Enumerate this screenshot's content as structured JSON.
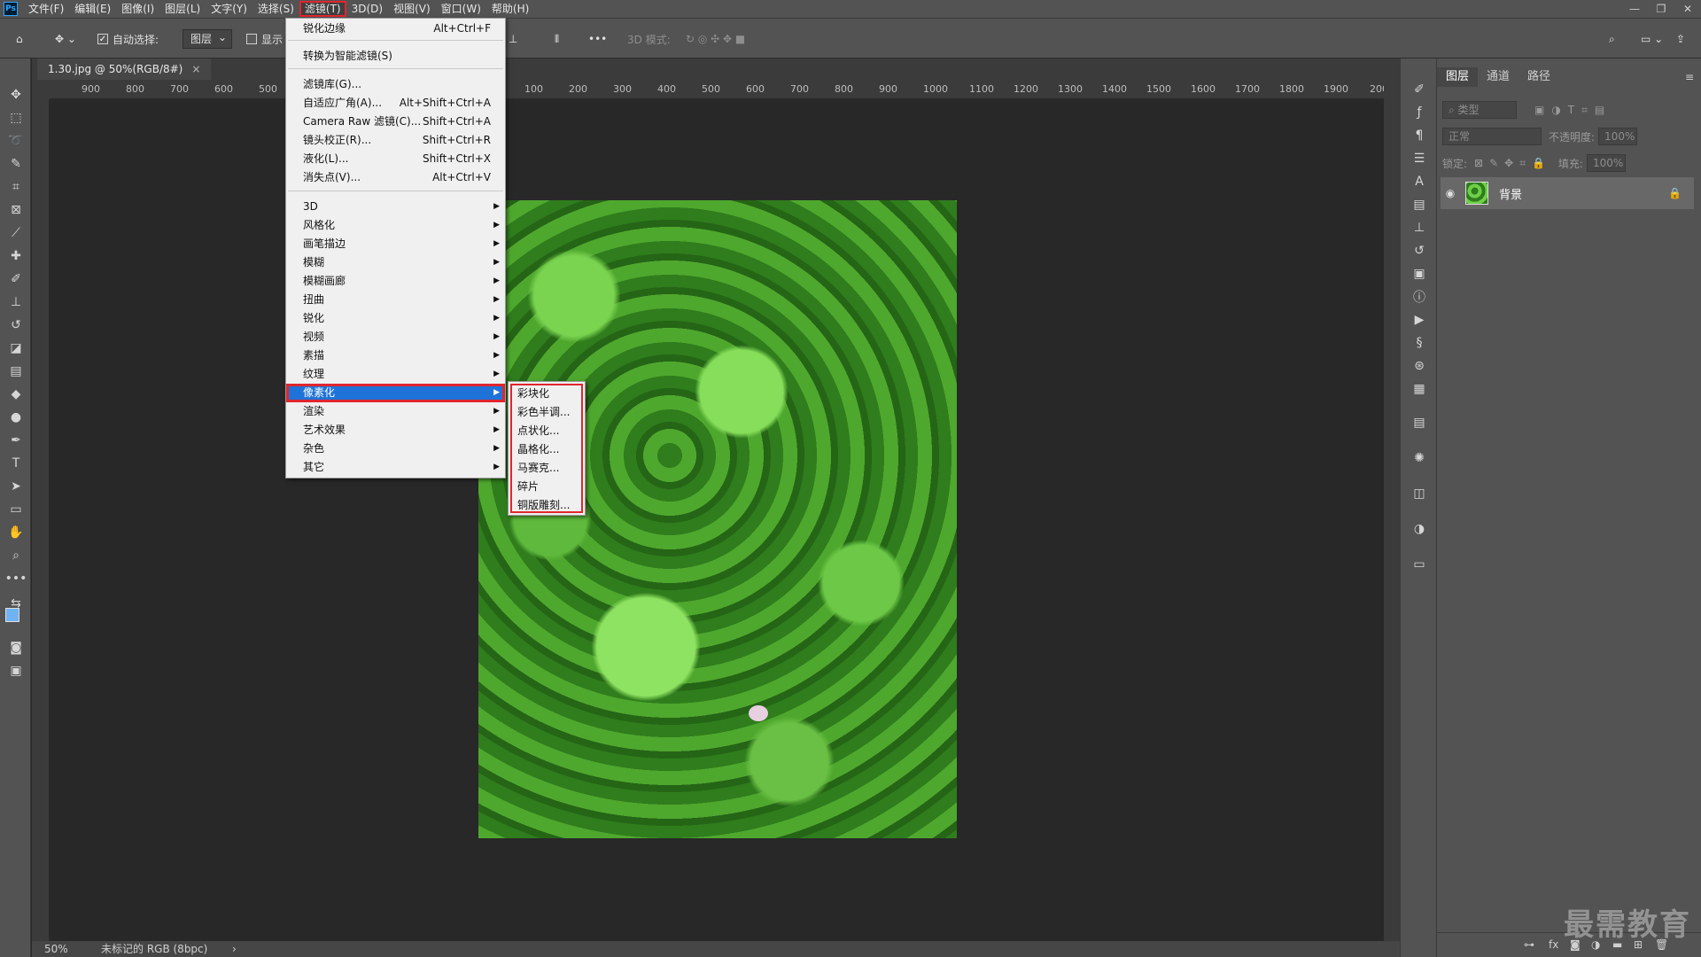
{
  "menubar": {
    "logo": "Ps",
    "items": [
      "文件(F)",
      "编辑(E)",
      "图像(I)",
      "图层(L)",
      "文字(Y)",
      "选择(S)",
      "滤镜(T)",
      "3D(D)",
      "视图(V)",
      "窗口(W)",
      "帮助(H)"
    ],
    "active_index": 6
  },
  "window_controls": {
    "minimize": "—",
    "restore": "❐",
    "close": "✕"
  },
  "options_bar": {
    "auto_select_label": "自动选择:",
    "auto_select_target": "图层",
    "show_label": "显示",
    "mode_label": "3D 模式:"
  },
  "document": {
    "tab_title": "1.30.jpg @ 50%(RGB/8#)",
    "tab_close": "×",
    "ruler_labels": [
      "900",
      "800",
      "700",
      "600",
      "500",
      "100",
      "200",
      "300",
      "400",
      "500",
      "600",
      "700",
      "800",
      "900",
      "1000",
      "1100",
      "1200",
      "1300",
      "1400",
      "1500",
      "1600",
      "1700",
      "1800",
      "1900",
      "200"
    ]
  },
  "statusbar": {
    "zoom": "50%",
    "profile": "未标记的 RGB (8bpc)",
    "arrow": "›"
  },
  "layers_panel": {
    "tabs": [
      "图层",
      "通道",
      "路径"
    ],
    "filter_placeholder": "类型",
    "blend_mode": "正常",
    "opacity_label": "不透明度:",
    "opacity_value": "100%",
    "lock_label": "锁定:",
    "fill_label": "填充:",
    "fill_value": "100%",
    "layer_name": "背景"
  },
  "filter_menu": {
    "items": [
      {
        "label": "锐化边缘",
        "shortcut": "Alt+Ctrl+F"
      },
      {
        "label": "转换为智能滤镜(S)",
        "shortcut": ""
      },
      {
        "label": "滤镜库(G)...",
        "shortcut": ""
      },
      {
        "label": "自适应广角(A)...",
        "shortcut": "Alt+Shift+Ctrl+A"
      },
      {
        "label": "Camera Raw 滤镜(C)...",
        "shortcut": "Shift+Ctrl+A"
      },
      {
        "label": "镜头校正(R)...",
        "shortcut": "Shift+Ctrl+R"
      },
      {
        "label": "液化(L)...",
        "shortcut": "Shift+Ctrl+X"
      },
      {
        "label": "消失点(V)...",
        "shortcut": "Alt+Ctrl+V"
      },
      {
        "label": "3D",
        "shortcut": ""
      },
      {
        "label": "风格化",
        "shortcut": ""
      },
      {
        "label": "画笔描边",
        "shortcut": ""
      },
      {
        "label": "模糊",
        "shortcut": ""
      },
      {
        "label": "模糊画廊",
        "shortcut": ""
      },
      {
        "label": "扭曲",
        "shortcut": ""
      },
      {
        "label": "锐化",
        "shortcut": ""
      },
      {
        "label": "视频",
        "shortcut": ""
      },
      {
        "label": "素描",
        "shortcut": ""
      },
      {
        "label": "纹理",
        "shortcut": ""
      },
      {
        "label": "像素化",
        "shortcut": ""
      },
      {
        "label": "渲染",
        "shortcut": ""
      },
      {
        "label": "艺术效果",
        "shortcut": ""
      },
      {
        "label": "杂色",
        "shortcut": ""
      },
      {
        "label": "其它",
        "shortcut": ""
      }
    ],
    "highlighted": "像素化"
  },
  "pixelate_submenu": {
    "items": [
      "彩块化",
      "彩色半调...",
      "点状化...",
      "晶格化...",
      "马赛克...",
      "碎片",
      "铜版雕刻..."
    ]
  },
  "watermark": "最需教育",
  "colors": {
    "highlight": "#1f73d8",
    "annotation_red": "#e0262f",
    "panel": "#535353",
    "canvas": "#282828"
  }
}
